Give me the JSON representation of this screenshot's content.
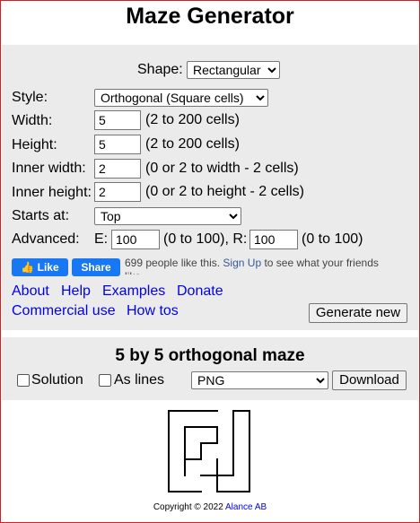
{
  "page": {
    "title": "Maze Generator"
  },
  "form": {
    "shape_label": "Shape:",
    "shape_value": "Rectangular",
    "style_label": "Style:",
    "style_value": "Orthogonal (Square cells)",
    "width_label": "Width:",
    "width_value": "5",
    "width_hint": "(2 to 200 cells)",
    "height_label": "Height:",
    "height_value": "5",
    "height_hint": "(2 to 200 cells)",
    "inner_width_label": "Inner width:",
    "inner_width_value": "2",
    "inner_width_hint": "(0 or 2 to width - 2 cells)",
    "inner_height_label": "Inner height:",
    "inner_height_value": "2",
    "inner_height_hint": "(0 or 2 to height - 2 cells)",
    "starts_label": "Starts at:",
    "starts_value": "Top",
    "advanced_label": "Advanced:",
    "e_label": "E:",
    "e_value": "100",
    "e_hint": "(0 to 100), R:",
    "r_value": "100",
    "r_hint": "(0 to 100)"
  },
  "facebook": {
    "like_label": "Like",
    "share_label": "Share",
    "text_before": "699 people like this.",
    "signup_link": "Sign Up",
    "text_after": "to see what your friends like."
  },
  "links": {
    "about": "About",
    "help": "Help",
    "examples": "Examples",
    "donate": "Donate",
    "commercial": "Commercial use",
    "howtos": "How tos"
  },
  "buttons": {
    "generate": "Generate new",
    "download": "Download"
  },
  "result": {
    "heading": "5 by 5 orthogonal maze",
    "solution_label": "Solution",
    "as_lines_label": "As lines",
    "format_value": "PNG"
  },
  "footer": {
    "copyright": "Copyright © 2022",
    "company": "Alance AB"
  },
  "colors": {
    "link": "#0000ee",
    "facebook": "#1877f2",
    "panel": "#ebebeb",
    "frame": "#d02020"
  }
}
